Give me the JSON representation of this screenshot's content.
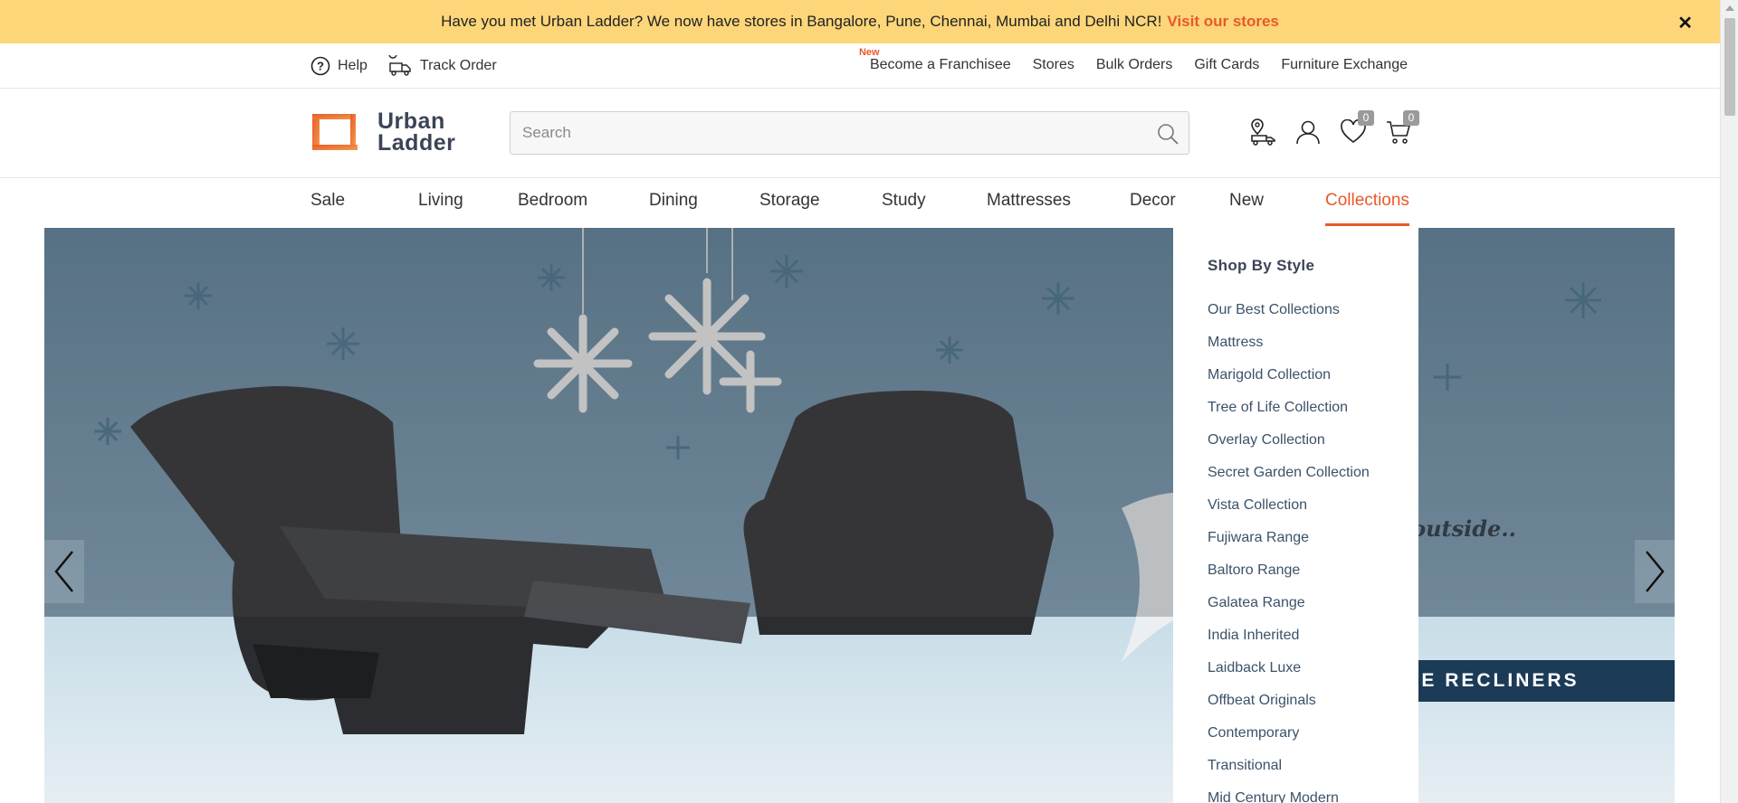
{
  "announcement": {
    "text": "Have you met Urban Ladder? We now have stores in Bangalore, Pune, Chennai, Mumbai and Delhi NCR!",
    "link": "Visit our stores",
    "close": "✕"
  },
  "utility": {
    "left": [
      {
        "label": "Help",
        "icon": "help-circle-icon"
      },
      {
        "label": "Track Order",
        "icon": "truck-icon"
      }
    ],
    "new_badge": "New",
    "right": [
      "Become a Franchisee",
      "Stores",
      "Bulk Orders",
      "Gift Cards",
      "Furniture Exchange"
    ]
  },
  "header": {
    "logo_line1": "Urban",
    "logo_line2": "Ladder",
    "search_placeholder": "Search",
    "wishlist_count": "0",
    "cart_count": "0"
  },
  "nav": {
    "items": [
      "Sale",
      "Living",
      "Bedroom",
      "Dining",
      "Storage",
      "Study",
      "Mattresses",
      "Decor",
      "New",
      "Collections"
    ],
    "active": "Collections"
  },
  "dropdown": {
    "heading": "Shop By Style",
    "items": [
      "Our Best Collections",
      "Mattress",
      "Marigold Collection",
      "Tree of Life Collection",
      "Overlay Collection",
      "Secret Garden Collection",
      "Vista Collection",
      "Fujiwara Range",
      "Baltoro Range",
      "Galatea Range",
      "India Inherited",
      "Laidback Luxe",
      "Offbeat Originals",
      "Contemporary",
      "Transitional",
      "Mid Century Modern"
    ]
  },
  "hero": {
    "tagline": "l outside..",
    "cta": "EXPLORE RECLINERS"
  },
  "colors": {
    "accent": "#e8592b",
    "banner": "#fcd679",
    "text_dark": "#3b4456",
    "cta_bg": "#1b3b57"
  }
}
